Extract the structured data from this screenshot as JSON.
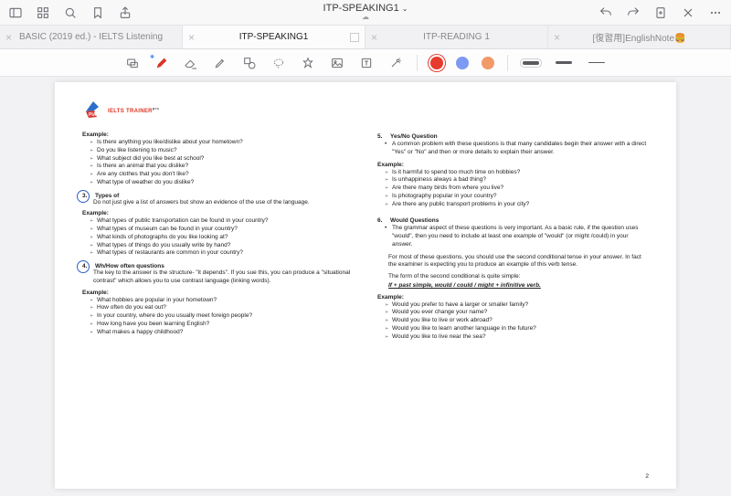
{
  "app": {
    "title": "ITP-SPEAKING1"
  },
  "tabs": [
    {
      "label": "BASIC (2019 ed.) - IELTS Listening"
    },
    {
      "label": "ITP-SPEAKING1"
    },
    {
      "label": "ITP-READING 1"
    },
    {
      "label": "[復習用]EnglishNote🍔"
    }
  ],
  "swatches": {
    "red": "#e63b2e",
    "blue": "#7d9af2",
    "orange": "#f29968"
  },
  "logo": {
    "brand": "IELTS TRAINER",
    "sup": "pro",
    "mark": "PIA"
  },
  "left": {
    "ex1_h": "Example:",
    "ex1": [
      "Is there anything you like/dislike about your hometown?",
      "Do you like listening to music?",
      "What subject did you like best at school?",
      "Is there an animal that you dislike?",
      "Are any clothes that you don't like?",
      "What type of weather do you dislike?"
    ],
    "s3_num": "3.",
    "s3_t": "Types of",
    "s3_body": "Do not just give a list of answers but show an evidence of the use of the language.",
    "ex2_h": "Example:",
    "ex2": [
      "What types of public transportation can be found in your country?",
      "What types of museum can be found in your country?",
      "What kinds of photographs do you like looking at?",
      "What types of things do you usually write by hand?",
      "What types of restaurants are common in your country?"
    ],
    "s4_num": "4.",
    "s4_t": "Wh/How often questions",
    "s4_body": "The key to the answer is the structure- \"it depends\". If you sue this, you can produce a \"situational contrast\" which allows you to use contrast language (linking words).",
    "ex3_h": "Example:",
    "ex3": [
      "What hobbies are popular in your hometown?",
      "How often do you eat out?",
      "In your country, where do you usually meet foreign people?",
      "How long have you been learning English?",
      "What makes a happy childhood?"
    ]
  },
  "right": {
    "s5_num": "5.",
    "s5_t": "Yes/No Question",
    "s5_bul": "A common problem with these questions is that many candidates begin their answer with a direct \"Yes\" or \"No\" and then or more details to explain their answer.",
    "ex4_h": "Example:",
    "ex4": [
      "Is it harmful to spend too much time on hobbies?",
      "Is unhappiness always a bad thing?",
      "Are there many birds from where you live?",
      "Is photography popular in your country?",
      "Are there any public transport problems in your city?"
    ],
    "s6_num": "6.",
    "s6_t": "Would Questions",
    "s6_bul": "The grammar aspect of these questions is very important. As a basic rule, if the question uses \"would\", then you need to include at least one example of \"would\" (or might /could) in your answer.",
    "s6_p1": "For most of these questions, you should use the second conditional tense in your answer. In fact the examiner is expecting you to produce an example of this verb tense.",
    "s6_p2": "The form of the second conditional is quite simple:",
    "s6_formula": "If + past simple, would / could / might + infinitive verb.",
    "ex5_h": "Example:",
    "ex5": [
      "Would you prefer to have a larger or smaller family?",
      "Would you ever change your name?",
      "Would you like to live or work abroad?",
      "Would you like to learn another language in the future?",
      "Would you like to live near the sea?"
    ]
  },
  "pagenum": "2"
}
